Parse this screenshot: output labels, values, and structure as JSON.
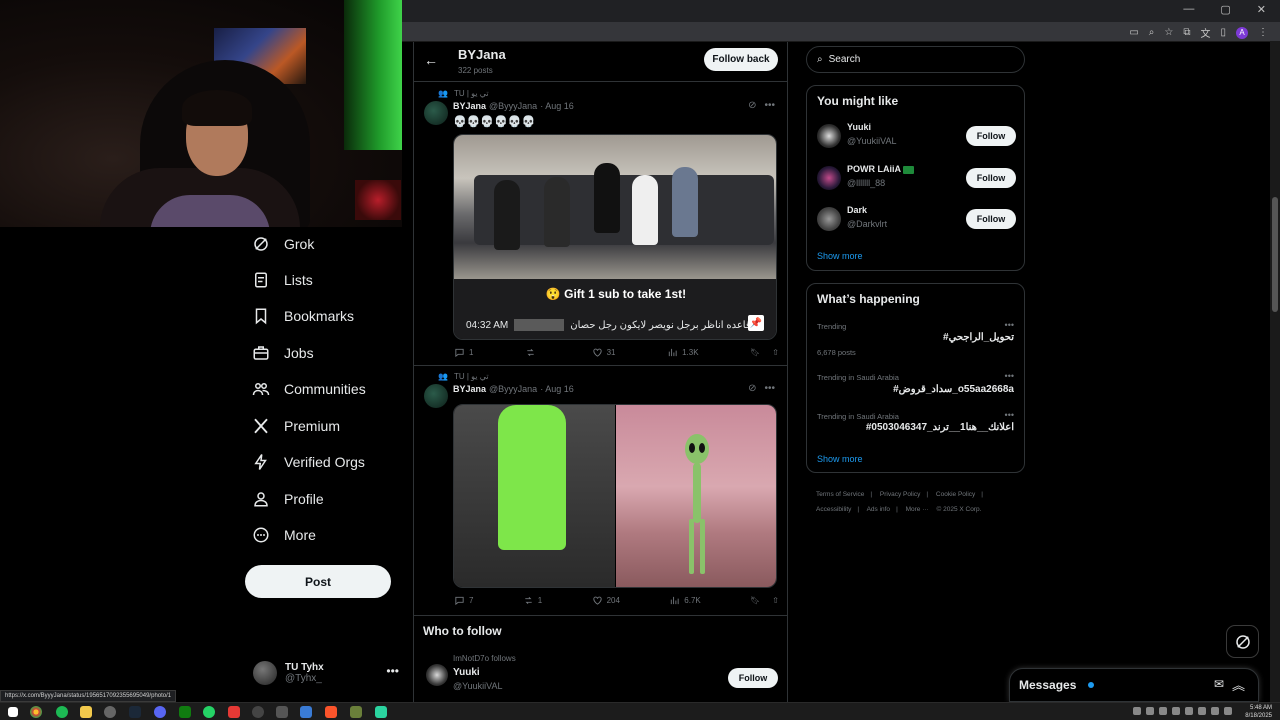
{
  "nav": {
    "items": [
      {
        "label": "Grok",
        "icon": "grok-icon"
      },
      {
        "label": "Lists",
        "icon": "lists-icon"
      },
      {
        "label": "Bookmarks",
        "icon": "bookmark-icon"
      },
      {
        "label": "Jobs",
        "icon": "briefcase-icon"
      },
      {
        "label": "Communities",
        "icon": "communities-icon"
      },
      {
        "label": "Premium",
        "icon": "x-logo-icon"
      },
      {
        "label": "Verified Orgs",
        "icon": "lightning-icon"
      },
      {
        "label": "Profile",
        "icon": "person-icon"
      },
      {
        "label": "More",
        "icon": "more-circle-icon"
      }
    ],
    "post_label": "Post"
  },
  "account": {
    "name": "TU Tyhx",
    "handle": "@Tyhx_"
  },
  "header": {
    "title": "BYJana",
    "subtitle": "322 posts",
    "follow_back": "Follow back"
  },
  "tweets": [
    {
      "repost": "TU | تي يو",
      "name": "BYJana",
      "handle": "@ByyyJana",
      "date": "· Aug 16",
      "text": "💀💀💀💀💀💀",
      "media_title": "😲 Gift 1 sub to take 1st!",
      "media_caption_time": "04:32 AM",
      "media_caption_text": "قاعده اناظر برجل نويصر لايكون رجل حصان",
      "stats": {
        "replies": "1",
        "reposts": "",
        "likes": "31",
        "views": "1.3K"
      }
    },
    {
      "repost": "TU | تي يو",
      "name": "BYJana",
      "handle": "@ByyyJana",
      "date": "· Aug 16",
      "stats": {
        "replies": "7",
        "reposts": "1",
        "likes": "204",
        "views": "6.7K"
      }
    }
  ],
  "who_to_follow": {
    "title": "Who to follow",
    "followed_by": "ImNotD7o follows",
    "name": "Yuuki",
    "handle": "@YuukiiVAL",
    "follow_label": "Follow"
  },
  "search": {
    "placeholder": "Search"
  },
  "you_might_like": {
    "title": "You might like",
    "users": [
      {
        "name": "Yuuki",
        "handle": "@YuukiiVAL",
        "follow": "Follow"
      },
      {
        "name": "POWR LAiiA",
        "handle": "@lllllll_88",
        "follow": "Follow"
      },
      {
        "name": "Dark",
        "handle": "@Darkvlrt",
        "follow": "Follow"
      }
    ],
    "show_more": "Show more"
  },
  "happening": {
    "title": "What’s happening",
    "trends": [
      {
        "label": "Trending",
        "name": "#تحويل_الراجحي",
        "posts": "6,678 posts"
      },
      {
        "label": "Trending in Saudi Arabia",
        "name": "#سداد_قروض_o55aa2668a",
        "posts": ""
      },
      {
        "label": "Trending in Saudi Arabia",
        "name": "#اعلانك__هنا1__ترند_0503046347",
        "posts": ""
      }
    ],
    "show_more": "Show more"
  },
  "footer": {
    "links": [
      "Terms of Service",
      "|",
      "Privacy Policy",
      "|",
      "Cookie Policy",
      "|",
      "Accessibility",
      "|",
      "Ads info",
      "|",
      "More ···",
      "© 2025 X Corp."
    ]
  },
  "messages": {
    "label": "Messages"
  },
  "status_url": "https://x.com/ByyyJana/status/1956517092355695049/photo/1",
  "taskbar": {
    "time": "5:48 AM",
    "date": "8/18/2025"
  },
  "colors": {
    "accent": "#1d9bf0",
    "background": "#000000",
    "border": "#2f3336",
    "muted": "#71767b"
  }
}
